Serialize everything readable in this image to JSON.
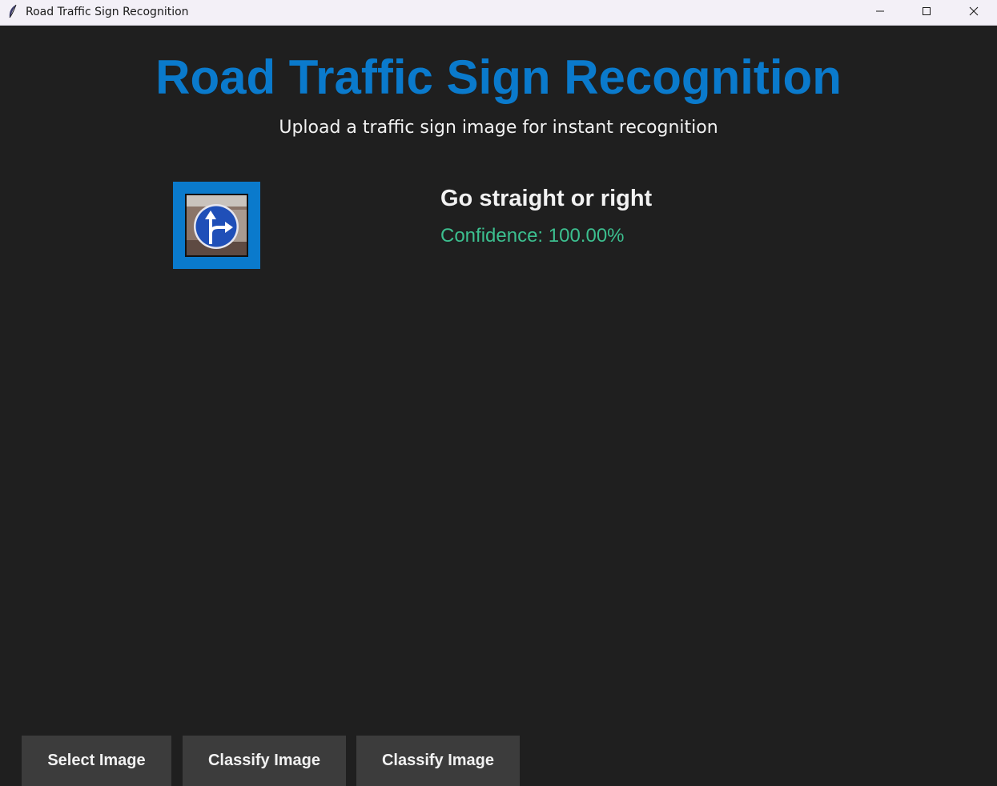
{
  "window": {
    "title": "Road Traffic Sign Recognition",
    "icon": "feather-icon",
    "controls": [
      "minimize-icon",
      "maximize-icon",
      "close-icon"
    ]
  },
  "header": {
    "title": "Road Traffic Sign Recognition",
    "subtitle": "Upload a traffic sign image for instant recognition"
  },
  "preview": {
    "image": "traffic-sign-go-straight-or-right"
  },
  "result": {
    "label": "Go straight or right",
    "confidence": "Confidence: 100.00%"
  },
  "buttons": {
    "select": "Select Image",
    "classify1": "Classify Image",
    "classify2": "Classify Image"
  },
  "colors": {
    "background": "#1f1f1f",
    "accent": "#0a7acc",
    "confidence": "#3cbf8f",
    "button_bg": "#3c3c3c"
  }
}
